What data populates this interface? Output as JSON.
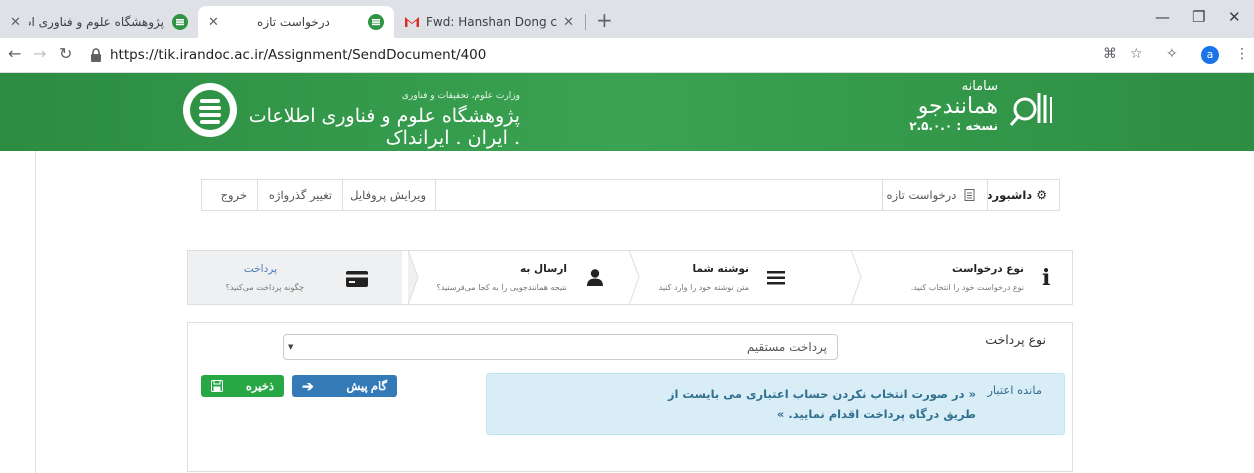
{
  "browser": {
    "tabs": [
      {
        "title": "پژوهشگاه علوم و فناوری اطلاعات |"
      },
      {
        "title": "درخواست تازه"
      },
      {
        "title": "Fwd: Hanshan Dong confirmed a"
      }
    ],
    "url": "https://tik.irandoc.ac.ir/Assignment/SendDocument/400",
    "profile_letter": "a"
  },
  "banner": {
    "ministry": "وزارت علوم، تحقیقات و فناوری",
    "institute": "پژوهشگاه علوم و فناوری اطلاعات ایران . ایرانداک .",
    "system_small": "سامانه",
    "system_name": "همانندجو",
    "version": "نسخه : ۲.۵.۰.۰"
  },
  "menu": {
    "dashboard": "داشبورد",
    "new_request": "درخواست تازه",
    "edit_profile": "ویرایش پروفایل",
    "change_password": "تغییر گذرواژه",
    "logout": "خروج"
  },
  "steps": [
    {
      "title": "نوع درخواست",
      "desc": "نوع درخواست خود را انتخاب کنید."
    },
    {
      "title": "نوشته شما",
      "desc": "متن نوشته خود را وارد کنید"
    },
    {
      "title": "ارسال به",
      "desc": "نتیجه همانندجویی را به کجا می‌فرستید؟"
    },
    {
      "title": "پرداخت",
      "desc": "چگونه پرداخت می‌کنید؟"
    }
  ],
  "form": {
    "payment_type_label": "نوع پرداخت",
    "payment_type_value": "پرداخت مستقیم",
    "credit_label": "مانده اعتبار",
    "alert_text": "« در صورت انتخاب نکردن حساب اعتباری می بایست از طریق درگاه پرداخت اقدام نمایید. »",
    "next_label": "گام پیش",
    "save_label": "ذخیره"
  },
  "colors": {
    "banner_green": "#3aa352",
    "primary_blue": "#337ab7",
    "success_green": "#28a745",
    "alert_bg": "#d9edf7",
    "alert_text": "#31708f"
  }
}
